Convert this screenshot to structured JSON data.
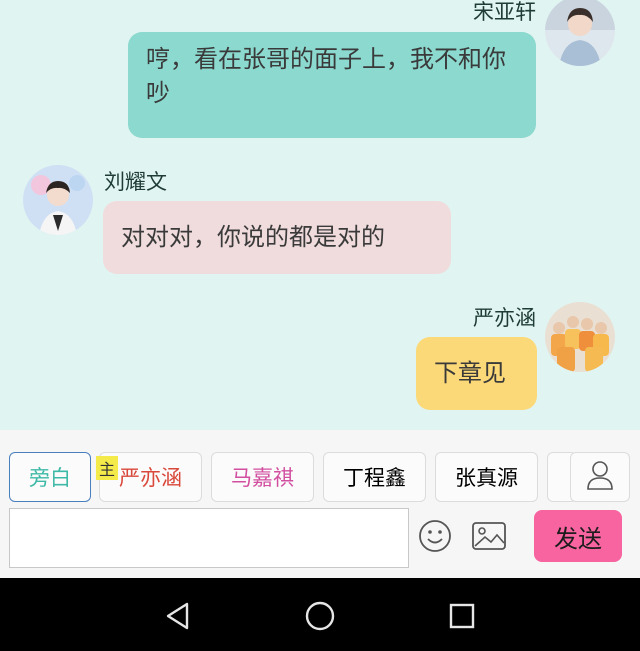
{
  "messages": [
    {
      "speaker": "宋亚轩",
      "text": "哼，看在张哥的面子上，我不和你吵",
      "side": "right",
      "bubble_color": "#8bd9cf"
    },
    {
      "speaker": "刘耀文",
      "text": "对对对，你说的都是对的",
      "side": "left",
      "bubble_color": "#f0dcdd"
    },
    {
      "speaker": "严亦涵",
      "text": "下章见",
      "side": "right",
      "bubble_color": "#fcd978"
    }
  ],
  "character_tabs": [
    {
      "label": "旁白",
      "color": "#555555",
      "active": true
    },
    {
      "label": "严亦涵",
      "color": "#3fb9a7",
      "active": false
    },
    {
      "label": "马嘉祺",
      "color": "#b47ad8",
      "active": false
    },
    {
      "label": "丁程鑫",
      "color": "#d9483b",
      "active": false
    },
    {
      "label": "张真源",
      "color": "#d24fa0",
      "active": false
    }
  ],
  "main_badge": "主",
  "input": {
    "value": "",
    "placeholder": ""
  },
  "send_label": "发送",
  "icons": {
    "emoji": "smiley-icon",
    "image": "image-icon",
    "profile": "person-icon",
    "nav_back": "back-triangle-icon",
    "nav_home": "home-circle-icon",
    "nav_recent": "recent-square-icon"
  },
  "colors": {
    "background": "#e0f4f1",
    "send_button": "#f764a0",
    "active_tab_border": "#4a7fbd"
  }
}
